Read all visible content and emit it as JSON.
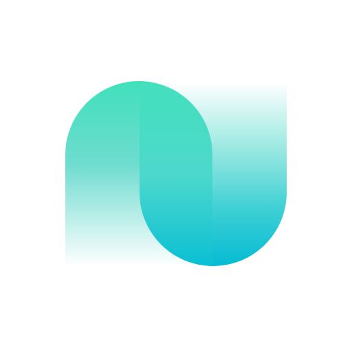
{
  "logo": {
    "name": "app-logo-icon",
    "colors": {
      "background": "#ffffff",
      "mint": "#3fe1b8",
      "teal": "#52d3d0",
      "cyan": "#05bcd3",
      "fade": "#ffffff"
    }
  }
}
